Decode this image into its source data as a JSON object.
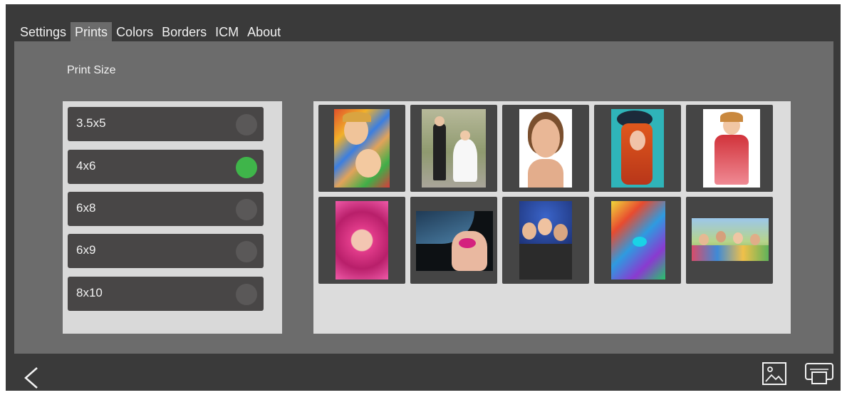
{
  "tabs": [
    {
      "label": "Settings",
      "active": false
    },
    {
      "label": "Prints",
      "active": true
    },
    {
      "label": "Colors",
      "active": false
    },
    {
      "label": "Borders",
      "active": false
    },
    {
      "label": "ICM",
      "active": false
    },
    {
      "label": "About",
      "active": false
    }
  ],
  "print_size": {
    "title": "Print Size",
    "options": [
      {
        "label": "3.5x5",
        "selected": false
      },
      {
        "label": "4x6",
        "selected": true
      },
      {
        "label": "6x8",
        "selected": false
      },
      {
        "label": "6x9",
        "selected": false
      },
      {
        "label": "8x10",
        "selected": false
      }
    ]
  },
  "photos": [
    {
      "name": "children-with-balls"
    },
    {
      "name": "wedding-kids"
    },
    {
      "name": "woman-portrait"
    },
    {
      "name": "red-hair-woman-hat"
    },
    {
      "name": "girl-red-dress"
    },
    {
      "name": "woman-pink-flowers"
    },
    {
      "name": "woman-blue-hair"
    },
    {
      "name": "party-friends"
    },
    {
      "name": "painted-face"
    },
    {
      "name": "group-outdoors"
    }
  ],
  "colors": {
    "window_bg": "#3a3a3a",
    "content_bg": "#6c6c6c",
    "panel_bg": "#d9d9d9",
    "option_bg": "#484646",
    "radio_off": "#5a5858",
    "radio_on": "#3fb54a"
  },
  "icons": {
    "back": "chevron-left-icon",
    "gallery": "image-icon",
    "printer": "printer-icon"
  }
}
